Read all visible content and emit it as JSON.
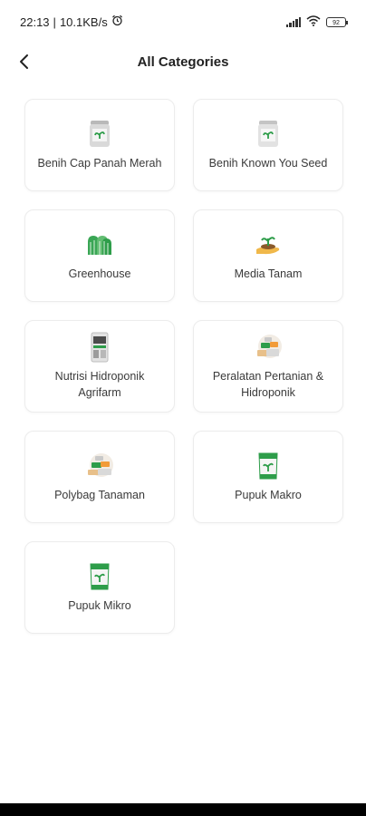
{
  "status": {
    "time": "22:13",
    "separator": "|",
    "speed": "10.1KB/s",
    "battery": "92"
  },
  "header": {
    "title": "All Categories"
  },
  "categories": [
    {
      "label": "Benih Cap Panah Merah",
      "icon": "seed-can-icon"
    },
    {
      "label": "Benih Known You Seed",
      "icon": "seed-can-icon"
    },
    {
      "label": "Greenhouse",
      "icon": "greenhouse-icon"
    },
    {
      "label": "Media Tanam",
      "icon": "sprout-hand-icon"
    },
    {
      "label": "Nutrisi Hidroponik Agrifarm",
      "icon": "nutrient-bottle-icon"
    },
    {
      "label": "Peralatan Pertanian & Hidroponik",
      "icon": "tools-pile-icon"
    },
    {
      "label": "Polybag Tanaman",
      "icon": "polybag-pile-icon"
    },
    {
      "label": "Pupuk Makro",
      "icon": "fertilizer-bag-icon"
    },
    {
      "label": "Pupuk Mikro",
      "icon": "fertilizer-bag-icon"
    }
  ],
  "colors": {
    "accent_green": "#2e9d4a",
    "card_border": "#ececec"
  }
}
